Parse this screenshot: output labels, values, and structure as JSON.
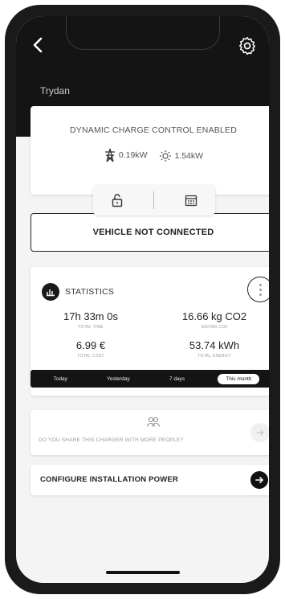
{
  "header": {
    "title": "Trydan"
  },
  "icons": {
    "back": "chevron-left-icon",
    "settings": "gear-icon",
    "grid": "grid-tower-icon",
    "sun": "sun-icon",
    "lock": "lock-open-icon",
    "calendar": "calendar-icon",
    "chart": "bar-chart-icon",
    "more": "more-vertical-icon",
    "people": "people-icon",
    "arrow": "arrow-right-icon"
  },
  "dynamic_charge": {
    "title": "DYNAMIC CHARGE CONTROL ENABLED",
    "grid_power": "0.19kW",
    "solar_power": "1.54kW"
  },
  "vehicle": {
    "status": "VEHICLE NOT CONNECTED"
  },
  "statistics": {
    "title": "STATISTICS",
    "items": [
      {
        "value": "17h 33m 0s",
        "label": "TOTAL TIME"
      },
      {
        "value": "16.66 kg CO2",
        "label": "SAVING CO2"
      },
      {
        "value": "6.99 €",
        "label": "TOTAL COST"
      },
      {
        "value": "53.74 kWh",
        "label": "TOTAL ENERGY"
      }
    ],
    "periods": [
      "Today",
      "Yesterday",
      "7 days",
      "This month"
    ],
    "active_period": "This month"
  },
  "share": {
    "text": "DO YOU SHARE THIS CHARGER WITH MORE PEOPLE?"
  },
  "config": {
    "label": "CONFIGURE INSTALLATION POWER"
  },
  "colors": {
    "header_bg": "#141414",
    "accent": "#111111",
    "card_bg": "#ffffff",
    "page_bg": "#f4f4f4"
  }
}
